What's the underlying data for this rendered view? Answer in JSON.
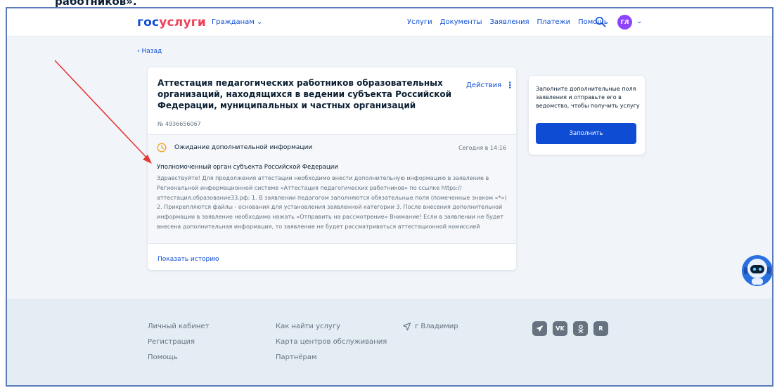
{
  "caption": "работников».",
  "header": {
    "logo_part1": "гос",
    "logo_part2": "услуги",
    "audience": "Гражданам ⌄",
    "nav": [
      "Услуги",
      "Документы",
      "Заявления",
      "Платежи",
      "Помощь"
    ],
    "avatar_initials": "ГЛ",
    "avatar_chevron": "⌄",
    "accent_color": "#0d4cd3",
    "logo_red": "#ee3f58",
    "avatar_color": "#8e44ff"
  },
  "back_link": "‹ Назад",
  "application": {
    "title": "Аттестация педагогических работников образовательных организаций, находящихся в ведении субъекта Российской Федерации, муниципальных и частных организаций",
    "number": "№ 4936656067",
    "actions_label": "Действия",
    "status": {
      "text": "Ожидание дополнительной информации",
      "time": "Сегодня в 14:16",
      "icon_color": "#f5a623"
    },
    "authority": "Уполномоченный орган субъекта Российской Федерации",
    "message": "Здравствуйте! Для продолжения аттестации необходимо внести дополнительную информацию в заявление в Региональной информационной системе «Аттестация педагогических работников» по ссылке https://аттестация.образование33.рф: 1. В заявлении педагогом заполняются обязательные поля (помеченные знаком «*») 2. Прикрепляются файлы - основания для установления заявленной категории 3. После внесения дополнительной информации в заявление необходимо нажать «Отправить на рассмотрение» Внимание! Если в заявлении не будет внесена дополнительная информация, то заявление не будет рассматриваться аттестационной комиссией",
    "history_link": "Показать историю"
  },
  "side": {
    "text": "Заполните дополнительные поля заявления и отправьте его в ведомство, чтобы получить услугу",
    "button_label": "Заполнить"
  },
  "footer": {
    "col1": [
      "Личный кабинет",
      "Регистрация",
      "Помощь"
    ],
    "col2": [
      "Как найти услугу",
      "Карта центров обслуживания",
      "Партнёрам"
    ],
    "city": "г Владимир",
    "socials": [
      "telegram-icon",
      "vk-icon",
      "ok-icon",
      "rutube-icon"
    ]
  },
  "annotation_color": "#e53935"
}
